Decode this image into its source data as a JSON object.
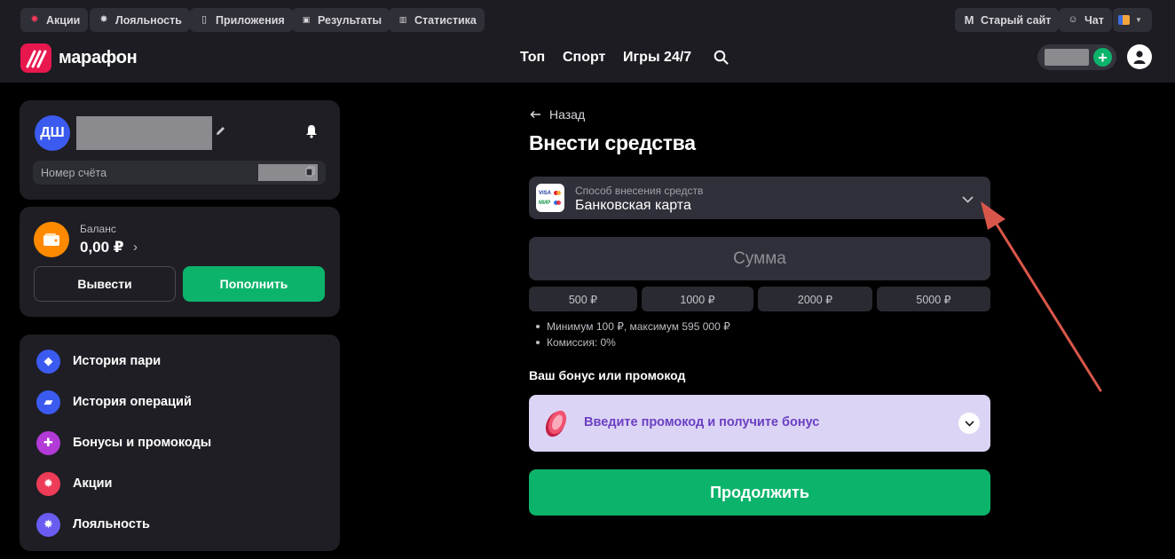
{
  "topbar": {
    "left_pills": [
      {
        "label": "Акции",
        "icon": "promo-icon"
      },
      {
        "label": "Лояльность",
        "icon": "star-icon"
      },
      {
        "label": "Приложения",
        "icon": "phone-icon"
      },
      {
        "label": "Результаты",
        "icon": "results-icon"
      },
      {
        "label": "Статистика",
        "icon": "stats-icon"
      }
    ],
    "old_site": "Старый сайт",
    "old_site_icon": "M",
    "chat": "Чат"
  },
  "header": {
    "logo_text": "марафон",
    "nav": [
      "Топ",
      "Спорт",
      "Игры 24/7"
    ]
  },
  "profile": {
    "initials": "ДШ",
    "account_label": "Номер счёта"
  },
  "balance": {
    "label": "Баланс",
    "amount": "0,00 ₽",
    "withdraw": "Вывести",
    "deposit": "Пополнить"
  },
  "menu": [
    {
      "label": "История пари",
      "icon": "bet-history-icon",
      "color": "#3b5bf0"
    },
    {
      "label": "История операций",
      "icon": "wallet-icon",
      "color": "#3b5bf0"
    },
    {
      "label": "Бонусы и промокоды",
      "icon": "gift-icon",
      "color": "#b23ad6"
    },
    {
      "label": "Акции",
      "icon": "promo-icon",
      "color": "#ee3b57"
    },
    {
      "label": "Лояльность",
      "icon": "star-icon",
      "color": "#6a5cf0"
    }
  ],
  "form": {
    "back": "Назад",
    "title": "Внести средства",
    "method_label": "Способ внесения средств",
    "method_value": "Банковская карта",
    "amount_placeholder": "Сумма",
    "presets": [
      "500 ₽",
      "1000 ₽",
      "2000 ₽",
      "5000 ₽"
    ],
    "notes": [
      "Минимум 100 ₽, максимум 595 000 ₽",
      "Комиссия: 0%"
    ],
    "bonus_title": "Ваш бонус или промокод",
    "promo_text": "Введите промокод и получите бонус",
    "continue": "Продолжить"
  },
  "colors": {
    "accent_green": "#0cb46b",
    "brand_red": "#e8174e",
    "annotation_arrow": "#d9574a"
  }
}
